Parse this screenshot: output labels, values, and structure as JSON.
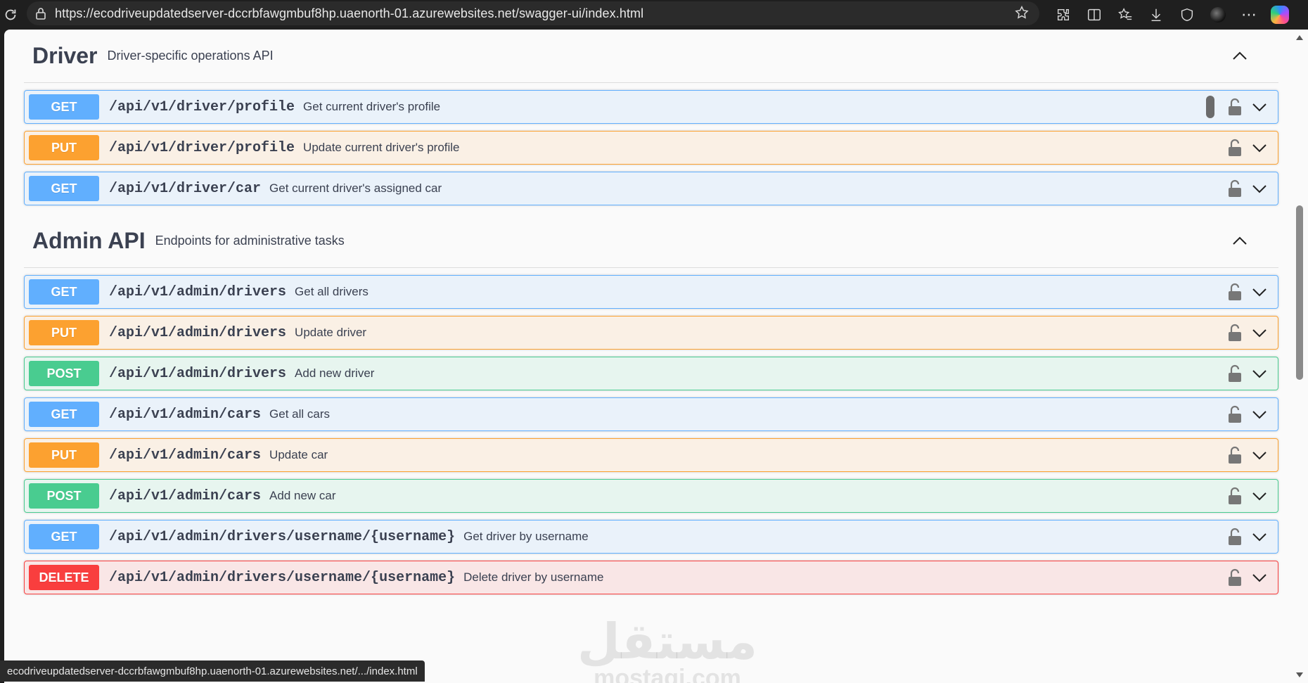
{
  "browser": {
    "url": "https://ecodriveupdatedserver-dccrbfawgmbuf8hp.uaenorth-01.azurewebsites.net/swagger-ui/index.html",
    "status_url": "ecodriveupdatedserver-dccrbfawgmbuf8hp.uaenorth-01.azurewebsites.net/.../index.html",
    "icons": [
      "refresh-icon",
      "lock-icon",
      "favorite-star-icon",
      "extensions-icon",
      "split-screen-icon",
      "favorites-icon",
      "downloads-icon",
      "browser-essentials-icon",
      "profile-avatar",
      "more-icon",
      "copilot-icon"
    ]
  },
  "sections": [
    {
      "title": "Driver",
      "description": "Driver-specific operations API",
      "operations": [
        {
          "method": "GET",
          "path": "/api/v1/driver/profile",
          "summary": "Get current driver's profile"
        },
        {
          "method": "PUT",
          "path": "/api/v1/driver/profile",
          "summary": "Update current driver's profile"
        },
        {
          "method": "GET",
          "path": "/api/v1/driver/car",
          "summary": "Get current driver's assigned car"
        }
      ]
    },
    {
      "title": "Admin API",
      "description": "Endpoints for administrative tasks",
      "operations": [
        {
          "method": "GET",
          "path": "/api/v1/admin/drivers",
          "summary": "Get all drivers"
        },
        {
          "method": "PUT",
          "path": "/api/v1/admin/drivers",
          "summary": "Update driver"
        },
        {
          "method": "POST",
          "path": "/api/v1/admin/drivers",
          "summary": "Add new driver"
        },
        {
          "method": "GET",
          "path": "/api/v1/admin/cars",
          "summary": "Get all cars"
        },
        {
          "method": "PUT",
          "path": "/api/v1/admin/cars",
          "summary": "Update car"
        },
        {
          "method": "POST",
          "path": "/api/v1/admin/cars",
          "summary": "Add new car"
        },
        {
          "method": "GET",
          "path": "/api/v1/admin/drivers/username/{username}",
          "summary": "Get driver by username"
        },
        {
          "method": "DELETE",
          "path": "/api/v1/admin/drivers/username/{username}",
          "summary": "Delete driver by username"
        }
      ]
    }
  ],
  "watermark": {
    "arabic": "مستقل",
    "latin": "mostaqi.com"
  },
  "colors": {
    "get": "#61affe",
    "put": "#fca130",
    "post": "#49cc90",
    "delete": "#f93e3e",
    "text": "#3b4151"
  }
}
